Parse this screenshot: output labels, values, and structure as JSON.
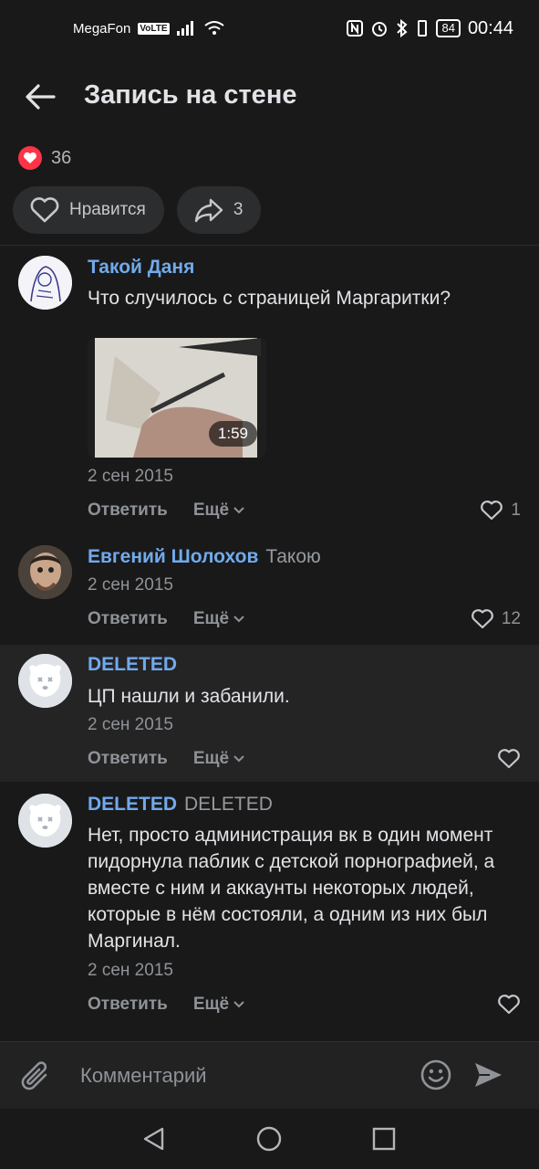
{
  "status_bar": {
    "carrier": "MegaFon",
    "volte": "VoLTE",
    "battery": "84",
    "time": "00:44"
  },
  "header": {
    "title": "Запись на стене"
  },
  "post": {
    "likes_count": "36",
    "like_button_label": "Нравится",
    "share_count": "3"
  },
  "comments": [
    {
      "author": "Такой Даня",
      "reply_to": "",
      "text": "Что случилось с страницей Маргаритки?",
      "video_duration": "1:59",
      "date": "2 сен 2015",
      "reply_label": "Ответить",
      "more_label": "Ещё",
      "likes": "1"
    },
    {
      "author": "Евгений Шолохов",
      "reply_to": "Такою",
      "text": "",
      "date": "2 сен 2015",
      "reply_label": "Ответить",
      "more_label": "Ещё",
      "likes": "12"
    },
    {
      "author": "DELETED",
      "reply_to": "",
      "text": "ЦП нашли и забанили.",
      "date": "2 сен 2015",
      "reply_label": "Ответить",
      "more_label": "Ещё",
      "likes": ""
    },
    {
      "author": "DELETED",
      "reply_to": "DELETED",
      "text": "Нет, просто администрация вк в один момент пидорнула паблик с детской порнографией, а вместе с ним и аккаунты некоторых людей, которые в нём состояли, а одним из них был Маргинал.",
      "date": "2 сен 2015",
      "reply_label": "Ответить",
      "more_label": "Ещё",
      "likes": ""
    }
  ],
  "composer": {
    "placeholder": "Комментарий"
  },
  "colors": {
    "background": "#191919",
    "accent_blue": "#71aaeb",
    "like_red": "#ff3347",
    "muted": "#8f9398"
  },
  "icons": [
    "back-arrow-icon",
    "heart-icon",
    "share-icon",
    "chevron-down-icon",
    "paperclip-icon",
    "smile-icon",
    "send-icon",
    "nav-back-icon",
    "nav-home-icon",
    "nav-recent-icon"
  ]
}
